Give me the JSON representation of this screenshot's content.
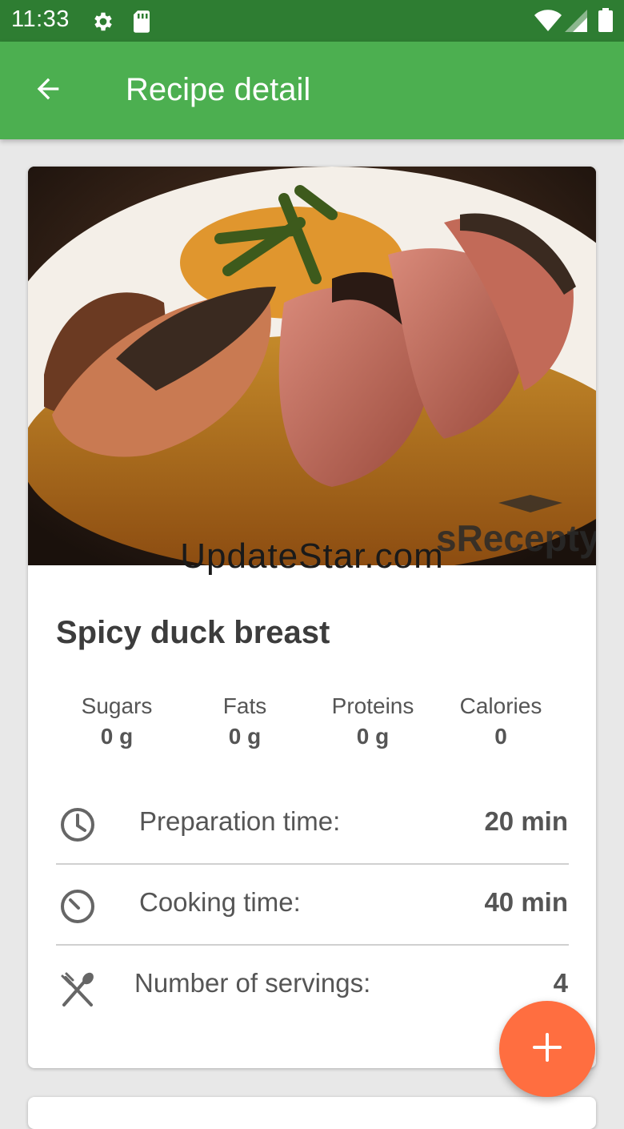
{
  "status_bar": {
    "time": "11:33",
    "icons": [
      "gear-icon",
      "sd-card-icon",
      "wifi-icon",
      "signal-icon",
      "battery-icon"
    ]
  },
  "app_bar": {
    "title": "Recipe detail",
    "back_icon": "arrow-back-icon",
    "color": "#4caf50"
  },
  "recipe": {
    "title": "Spicy duck breast",
    "image_watermark": "sRecepty",
    "overlay_watermark": "UpdateStar.com",
    "nutrition": [
      {
        "label": "Sugars",
        "value": "0 g"
      },
      {
        "label": "Fats",
        "value": "0 g"
      },
      {
        "label": "Proteins",
        "value": "0 g"
      },
      {
        "label": "Calories",
        "value": "0"
      }
    ],
    "details": [
      {
        "icon": "clock-icon",
        "label": "Preparation time:",
        "value": "20 min"
      },
      {
        "icon": "timer-icon",
        "label": "Cooking time:",
        "value": "40 min"
      },
      {
        "icon": "cutlery-icon",
        "label": "Number of servings:",
        "value": "4"
      }
    ]
  },
  "fab": {
    "icon": "plus-icon",
    "color": "#ff6e40"
  }
}
